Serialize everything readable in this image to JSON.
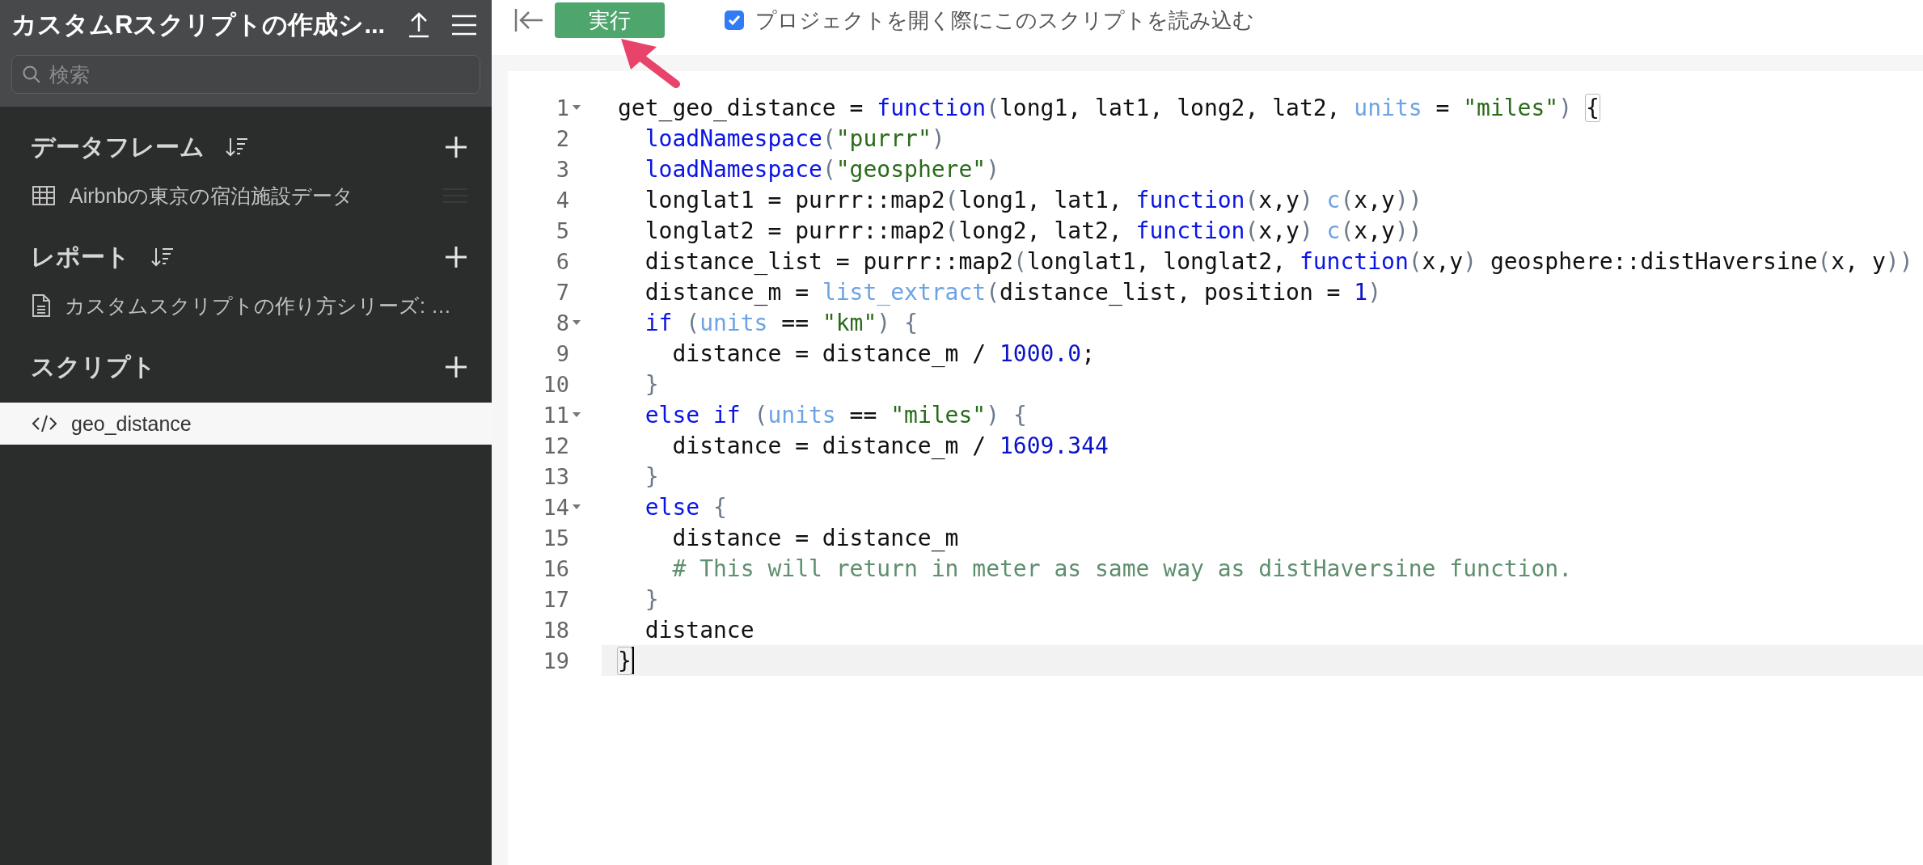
{
  "sidebar": {
    "title": "カスタムRスクリプトの作成シ...",
    "search": {
      "placeholder": "検索"
    },
    "sections": [
      {
        "title": "データフレーム",
        "sortable": true,
        "items": [
          {
            "label": "Airbnbの東京の宿泊施設データ",
            "kind": "table",
            "selected": false,
            "handle": true
          }
        ]
      },
      {
        "title": "レポート",
        "sortable": true,
        "items": [
          {
            "label": "カスタムスクリプトの作り方シリーズ: …",
            "kind": "document",
            "selected": false,
            "handle": false
          }
        ]
      },
      {
        "title": "スクリプト",
        "sortable": false,
        "items": [
          {
            "label": "geo_distance",
            "kind": "code",
            "selected": true,
            "handle": false
          }
        ]
      }
    ]
  },
  "toolbar": {
    "run_button": "実行",
    "load_on_open": {
      "label": "プロジェクトを開く際にこのスクリプトを読み込む",
      "checked": true
    }
  },
  "editor": {
    "lines": [
      {
        "number": "1",
        "foldable": true,
        "active": false,
        "tokens": [
          {
            "kind": "plain",
            "text": "get_geo_distance = "
          },
          {
            "kind": "keyword",
            "text": "function"
          },
          {
            "kind": "paren",
            "text": "("
          },
          {
            "kind": "plain",
            "text": "long1, lat1, long2, lat2, "
          },
          {
            "kind": "builtin",
            "text": "units"
          },
          {
            "kind": "plain",
            "text": " = "
          },
          {
            "kind": "string",
            "text": "\"miles\""
          },
          {
            "kind": "paren",
            "text": ") "
          },
          {
            "kind": "match",
            "text": "{"
          }
        ]
      },
      {
        "number": "2",
        "foldable": false,
        "active": false,
        "tokens": [
          {
            "kind": "keyword",
            "text": "  loadNamespace"
          },
          {
            "kind": "paren",
            "text": "("
          },
          {
            "kind": "string",
            "text": "\"purrr\""
          },
          {
            "kind": "paren",
            "text": ")"
          }
        ]
      },
      {
        "number": "3",
        "foldable": false,
        "active": false,
        "tokens": [
          {
            "kind": "keyword",
            "text": "  loadNamespace"
          },
          {
            "kind": "paren",
            "text": "("
          },
          {
            "kind": "string",
            "text": "\"geosphere\""
          },
          {
            "kind": "paren",
            "text": ")"
          }
        ]
      },
      {
        "number": "4",
        "foldable": false,
        "active": false,
        "tokens": [
          {
            "kind": "plain",
            "text": "  longlat1 = purrr::map2"
          },
          {
            "kind": "paren",
            "text": "("
          },
          {
            "kind": "plain",
            "text": "long1, lat1, "
          },
          {
            "kind": "keyword",
            "text": "function"
          },
          {
            "kind": "paren",
            "text": "("
          },
          {
            "kind": "plain",
            "text": "x,y"
          },
          {
            "kind": "paren",
            "text": ") "
          },
          {
            "kind": "builtin",
            "text": "c"
          },
          {
            "kind": "paren",
            "text": "("
          },
          {
            "kind": "plain",
            "text": "x,y"
          },
          {
            "kind": "paren",
            "text": "))"
          }
        ]
      },
      {
        "number": "5",
        "foldable": false,
        "active": false,
        "tokens": [
          {
            "kind": "plain",
            "text": "  longlat2 = purrr::map2"
          },
          {
            "kind": "paren",
            "text": "("
          },
          {
            "kind": "plain",
            "text": "long2, lat2, "
          },
          {
            "kind": "keyword",
            "text": "function"
          },
          {
            "kind": "paren",
            "text": "("
          },
          {
            "kind": "plain",
            "text": "x,y"
          },
          {
            "kind": "paren",
            "text": ") "
          },
          {
            "kind": "builtin",
            "text": "c"
          },
          {
            "kind": "paren",
            "text": "("
          },
          {
            "kind": "plain",
            "text": "x,y"
          },
          {
            "kind": "paren",
            "text": "))"
          }
        ]
      },
      {
        "number": "6",
        "foldable": false,
        "active": false,
        "tokens": [
          {
            "kind": "plain",
            "text": "  distance_list = purrr::map2"
          },
          {
            "kind": "paren",
            "text": "("
          },
          {
            "kind": "plain",
            "text": "longlat1, longlat2, "
          },
          {
            "kind": "keyword",
            "text": "function"
          },
          {
            "kind": "paren",
            "text": "("
          },
          {
            "kind": "plain",
            "text": "x,y"
          },
          {
            "kind": "paren",
            "text": ")"
          },
          {
            "kind": "plain",
            "text": " geosphere::distHaversine"
          },
          {
            "kind": "paren",
            "text": "("
          },
          {
            "kind": "plain",
            "text": "x, y"
          },
          {
            "kind": "paren",
            "text": "))"
          }
        ]
      },
      {
        "number": "7",
        "foldable": false,
        "active": false,
        "tokens": [
          {
            "kind": "plain",
            "text": "  distance_m = "
          },
          {
            "kind": "builtin",
            "text": "list_extract"
          },
          {
            "kind": "paren",
            "text": "("
          },
          {
            "kind": "plain",
            "text": "distance_list, position = "
          },
          {
            "kind": "number",
            "text": "1"
          },
          {
            "kind": "paren",
            "text": ")"
          }
        ]
      },
      {
        "number": "8",
        "foldable": true,
        "active": false,
        "tokens": [
          {
            "kind": "keyword",
            "text": "  if"
          },
          {
            "kind": "paren",
            "text": " ("
          },
          {
            "kind": "builtin",
            "text": "units"
          },
          {
            "kind": "plain",
            "text": " == "
          },
          {
            "kind": "string",
            "text": "\"km\""
          },
          {
            "kind": "paren",
            "text": ") {"
          }
        ]
      },
      {
        "number": "9",
        "foldable": false,
        "active": false,
        "tokens": [
          {
            "kind": "plain",
            "text": "    distance = distance_m / "
          },
          {
            "kind": "number",
            "text": "1000.0"
          },
          {
            "kind": "plain",
            "text": ";"
          }
        ]
      },
      {
        "number": "10",
        "foldable": false,
        "active": false,
        "tokens": [
          {
            "kind": "paren",
            "text": "  }"
          }
        ]
      },
      {
        "number": "11",
        "foldable": true,
        "active": false,
        "tokens": [
          {
            "kind": "keyword",
            "text": "  else if"
          },
          {
            "kind": "paren",
            "text": " ("
          },
          {
            "kind": "builtin",
            "text": "units"
          },
          {
            "kind": "plain",
            "text": " == "
          },
          {
            "kind": "string",
            "text": "\"miles\""
          },
          {
            "kind": "paren",
            "text": ") {"
          }
        ]
      },
      {
        "number": "12",
        "foldable": false,
        "active": false,
        "tokens": [
          {
            "kind": "plain",
            "text": "    distance = distance_m / "
          },
          {
            "kind": "number",
            "text": "1609.344"
          }
        ]
      },
      {
        "number": "13",
        "foldable": false,
        "active": false,
        "tokens": [
          {
            "kind": "paren",
            "text": "  }"
          }
        ]
      },
      {
        "number": "14",
        "foldable": true,
        "active": false,
        "tokens": [
          {
            "kind": "keyword",
            "text": "  else"
          },
          {
            "kind": "paren",
            "text": " {"
          }
        ]
      },
      {
        "number": "15",
        "foldable": false,
        "active": false,
        "tokens": [
          {
            "kind": "plain",
            "text": "    distance = distance_m"
          }
        ]
      },
      {
        "number": "16",
        "foldable": false,
        "active": false,
        "tokens": [
          {
            "kind": "comment",
            "text": "    # This will return in meter as same way as distHaversine function."
          }
        ]
      },
      {
        "number": "17",
        "foldable": false,
        "active": false,
        "tokens": [
          {
            "kind": "paren",
            "text": "  }"
          }
        ]
      },
      {
        "number": "18",
        "foldable": false,
        "active": false,
        "tokens": [
          {
            "kind": "plain",
            "text": "  distance"
          }
        ]
      },
      {
        "number": "19",
        "foldable": false,
        "active": true,
        "tokens": [
          {
            "kind": "match",
            "text": "}"
          }
        ]
      }
    ]
  }
}
